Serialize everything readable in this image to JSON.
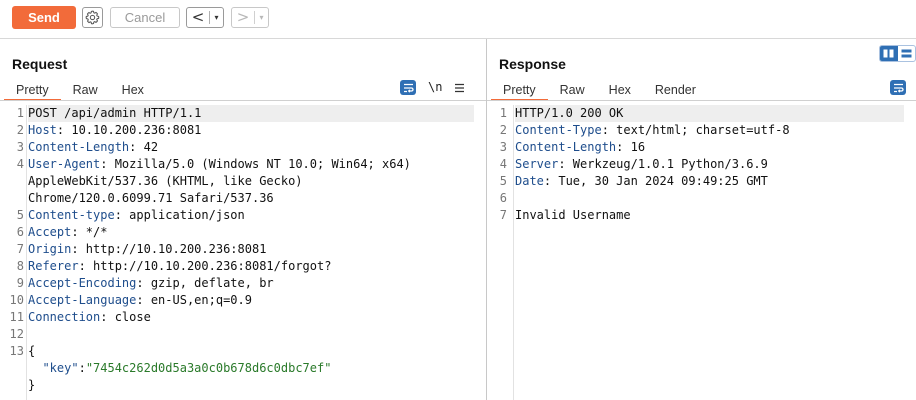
{
  "toolbar": {
    "send_label": "Send",
    "cancel_label": "Cancel",
    "back_glyph": "<",
    "forward_glyph": ">",
    "dropdown_glyph": "▾",
    "settings_icon": "gear-icon"
  },
  "colors": {
    "accent": "#f26b3a",
    "blue": "#2f6fb4",
    "header_name": "#1e4d8c",
    "json_string": "#2a7a2a"
  },
  "request": {
    "title": "Request",
    "tabs": [
      "Pretty",
      "Raw",
      "Hex"
    ],
    "active_tab": "Pretty",
    "newline_toggle": "\\n",
    "lines": [
      {
        "n": "1",
        "parts": [
          {
            "t": "POST /api/admin HTTP/1.1",
            "c": ""
          }
        ]
      },
      {
        "n": "2",
        "parts": [
          {
            "t": "Host",
            "c": "hname"
          },
          {
            "t": ": 10.10.200.236:8081",
            "c": ""
          }
        ]
      },
      {
        "n": "3",
        "parts": [
          {
            "t": "Content-Length",
            "c": "hname"
          },
          {
            "t": ": 42",
            "c": ""
          }
        ]
      },
      {
        "n": "4",
        "parts": [
          {
            "t": "User-Agent",
            "c": "hname"
          },
          {
            "t": ": Mozilla/5.0 (Windows NT 10.0; Win64; x64)",
            "c": ""
          }
        ]
      },
      {
        "n": "",
        "parts": [
          {
            "t": "AppleWebKit/537.36 (KHTML, like Gecko)",
            "c": ""
          }
        ]
      },
      {
        "n": "",
        "parts": [
          {
            "t": "Chrome/120.0.6099.71 Safari/537.36",
            "c": ""
          }
        ]
      },
      {
        "n": "5",
        "parts": [
          {
            "t": "Content-type",
            "c": "hname"
          },
          {
            "t": ": application/json",
            "c": ""
          }
        ]
      },
      {
        "n": "6",
        "parts": [
          {
            "t": "Accept",
            "c": "hname"
          },
          {
            "t": ": */*",
            "c": ""
          }
        ]
      },
      {
        "n": "7",
        "parts": [
          {
            "t": "Origin",
            "c": "hname"
          },
          {
            "t": ": http://10.10.200.236:8081",
            "c": ""
          }
        ]
      },
      {
        "n": "8",
        "parts": [
          {
            "t": "Referer",
            "c": "hname"
          },
          {
            "t": ": http://10.10.200.236:8081/forgot?",
            "c": ""
          }
        ]
      },
      {
        "n": "9",
        "parts": [
          {
            "t": "Accept-Encoding",
            "c": "hname"
          },
          {
            "t": ": gzip, deflate, br",
            "c": ""
          }
        ]
      },
      {
        "n": "10",
        "parts": [
          {
            "t": "Accept-Language",
            "c": "hname"
          },
          {
            "t": ": en-US,en;q=0.9",
            "c": ""
          }
        ]
      },
      {
        "n": "11",
        "parts": [
          {
            "t": "Connection",
            "c": "hname"
          },
          {
            "t": ": close",
            "c": ""
          }
        ]
      },
      {
        "n": "12",
        "parts": []
      },
      {
        "n": "13",
        "parts": [
          {
            "t": "{",
            "c": ""
          }
        ]
      },
      {
        "n": "",
        "parts": [
          {
            "t": "  ",
            "c": ""
          },
          {
            "t": "\"key\"",
            "c": "jkey"
          },
          {
            "t": ":",
            "c": ""
          },
          {
            "t": "\"7454c262d0d5a3a0c0b678d6c0dbc7ef\"",
            "c": "jval"
          }
        ]
      },
      {
        "n": "",
        "parts": [
          {
            "t": "}",
            "c": ""
          }
        ]
      }
    ]
  },
  "response": {
    "title": "Response",
    "tabs": [
      "Pretty",
      "Raw",
      "Hex",
      "Render"
    ],
    "active_tab": "Pretty",
    "lines": [
      {
        "n": "1",
        "parts": [
          {
            "t": "HTTP/1.0 200 OK",
            "c": ""
          }
        ]
      },
      {
        "n": "2",
        "parts": [
          {
            "t": "Content-Type",
            "c": "hname"
          },
          {
            "t": ": text/html; charset=utf-8",
            "c": ""
          }
        ]
      },
      {
        "n": "3",
        "parts": [
          {
            "t": "Content-Length",
            "c": "hname"
          },
          {
            "t": ": 16",
            "c": ""
          }
        ]
      },
      {
        "n": "4",
        "parts": [
          {
            "t": "Server",
            "c": "hname"
          },
          {
            "t": ": Werkzeug/1.0.1 Python/3.6.9",
            "c": ""
          }
        ]
      },
      {
        "n": "5",
        "parts": [
          {
            "t": "Date",
            "c": "hname"
          },
          {
            "t": ": Tue, 30 Jan 2024 09:49:25 GMT",
            "c": ""
          }
        ]
      },
      {
        "n": "6",
        "parts": []
      },
      {
        "n": "7",
        "parts": [
          {
            "t": "Invalid Username",
            "c": ""
          }
        ]
      }
    ]
  }
}
